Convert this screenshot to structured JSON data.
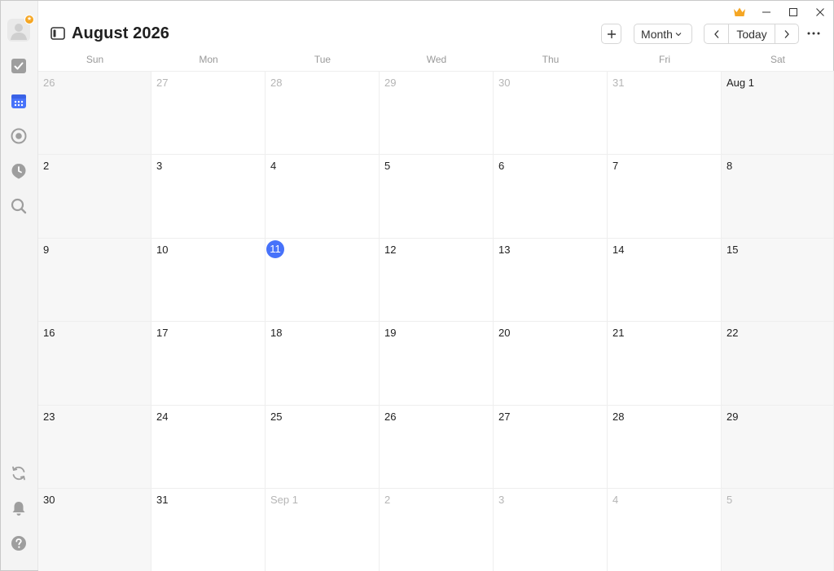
{
  "window": {
    "controls": [
      "minimize-icon",
      "maximize-icon",
      "close-icon"
    ],
    "premium_icon": "crown-icon",
    "accent_color": "#4772fa",
    "premium_color": "#f5a623"
  },
  "sidebar": {
    "items": [
      {
        "name": "tasks",
        "icon": "checkbox-icon",
        "active": false
      },
      {
        "name": "calendar",
        "icon": "calendar-icon",
        "active": true
      },
      {
        "name": "habit",
        "icon": "target-icon",
        "active": false
      },
      {
        "name": "focus",
        "icon": "clock-pin-icon",
        "active": false
      },
      {
        "name": "search",
        "icon": "search-icon",
        "active": false
      }
    ],
    "bottom_items": [
      {
        "name": "sync",
        "icon": "sync-icon"
      },
      {
        "name": "notifications",
        "icon": "bell-icon"
      },
      {
        "name": "help",
        "icon": "help-icon"
      }
    ]
  },
  "header": {
    "title": "August 2026",
    "add_label": "+",
    "view_label": "Month",
    "today_label": "Today"
  },
  "calendar": {
    "weekdays": [
      "Sun",
      "Mon",
      "Tue",
      "Wed",
      "Thu",
      "Fri",
      "Sat"
    ],
    "weeks": [
      [
        "26",
        "27",
        "28",
        "29",
        "30",
        "31",
        "Aug 1"
      ],
      [
        "2",
        "3",
        "4",
        "5",
        "6",
        "7",
        "8"
      ],
      [
        "9",
        "10",
        "11",
        "12",
        "13",
        "14",
        "15"
      ],
      [
        "16",
        "17",
        "18",
        "19",
        "20",
        "21",
        "22"
      ],
      [
        "23",
        "24",
        "25",
        "26",
        "27",
        "28",
        "29"
      ],
      [
        "30",
        "31",
        "Sep 1",
        "2",
        "3",
        "4",
        "5"
      ]
    ],
    "other_month": [
      [
        true,
        true,
        true,
        true,
        true,
        true,
        false
      ],
      [
        false,
        false,
        false,
        false,
        false,
        false,
        false
      ],
      [
        false,
        false,
        false,
        false,
        false,
        false,
        false
      ],
      [
        false,
        false,
        false,
        false,
        false,
        false,
        false
      ],
      [
        false,
        false,
        false,
        false,
        false,
        false,
        false
      ],
      [
        false,
        false,
        true,
        true,
        true,
        true,
        true
      ]
    ],
    "today": {
      "week": 2,
      "day": 2
    }
  }
}
